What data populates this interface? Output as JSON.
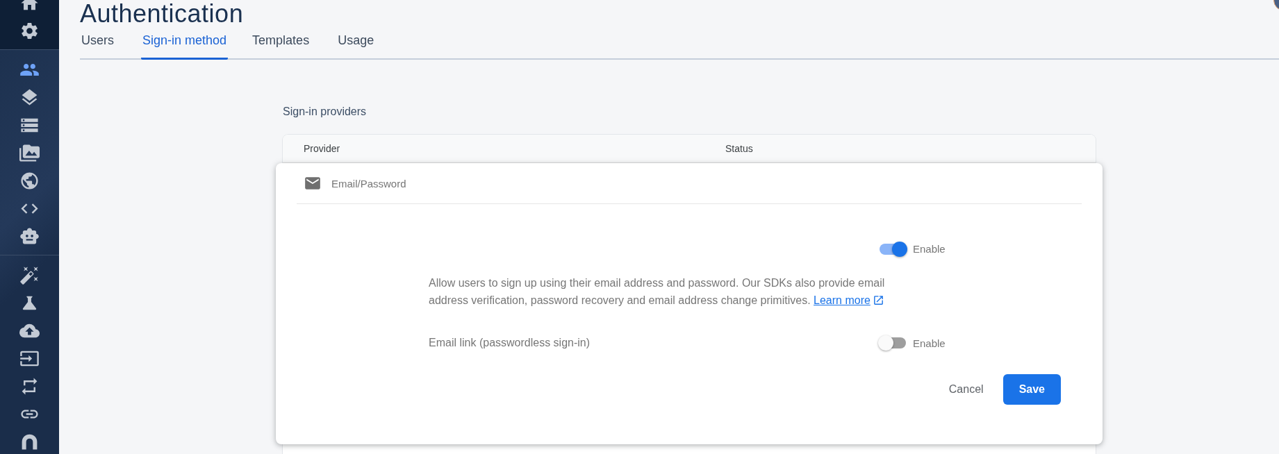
{
  "sidebar": {
    "groups": [
      {
        "items": [
          {
            "selected": false
          },
          {
            "selected": false
          }
        ]
      },
      {
        "items": [
          {
            "selected": true
          },
          {
            "selected": false
          },
          {
            "selected": false
          },
          {
            "selected": false
          },
          {
            "selected": false
          },
          {
            "selected": false
          },
          {
            "selected": false
          }
        ]
      },
      {
        "items": [
          {
            "selected": false
          },
          {
            "selected": false
          },
          {
            "selected": false
          },
          {
            "selected": false
          },
          {
            "selected": false
          },
          {
            "selected": false
          },
          {
            "selected": false
          }
        ]
      }
    ]
  },
  "page_title": "Authentication",
  "tabs": [
    {
      "label": "Users",
      "selected": false
    },
    {
      "label": "Sign-in method",
      "selected": true
    },
    {
      "label": "Templates",
      "selected": false
    },
    {
      "label": "Usage",
      "selected": false
    }
  ],
  "section_title": "Sign-in providers",
  "table": {
    "columns": [
      "Provider",
      "Status"
    ]
  },
  "provider": {
    "name": "Email/Password",
    "options": [
      {
        "kind": "toggle",
        "on": true,
        "toggle_label": "Enable"
      },
      {
        "kind": "text",
        "text": "Allow users to sign up using their email address and password. Our SDKs also provide email address verification, password recovery and email address change primitives.",
        "link": "Learn more"
      },
      {
        "kind": "toggle",
        "label": "Email link (passwordless sign-in)",
        "on": false,
        "toggle_label": "Enable"
      }
    ],
    "buttons": [
      {
        "label": "Cancel",
        "kind": "text"
      },
      {
        "label": "Save",
        "kind": "primary"
      }
    ]
  }
}
